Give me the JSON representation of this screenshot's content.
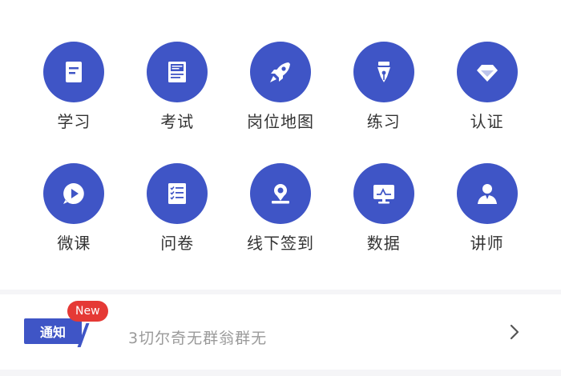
{
  "theme": {
    "accent": "#3f55c6",
    "new_badge": "#e53935"
  },
  "menu": {
    "items": [
      {
        "label": "学习",
        "icon": "document-icon"
      },
      {
        "label": "考试",
        "icon": "exam-paper-icon"
      },
      {
        "label": "岗位地图",
        "icon": "rocket-icon"
      },
      {
        "label": "练习",
        "icon": "pen-nib-icon"
      },
      {
        "label": "认证",
        "icon": "diamond-icon"
      },
      {
        "label": "微课",
        "icon": "play-bubble-icon"
      },
      {
        "label": "问卷",
        "icon": "checklist-icon"
      },
      {
        "label": "线下签到",
        "icon": "location-pin-icon"
      },
      {
        "label": "数据",
        "icon": "monitor-chart-icon"
      },
      {
        "label": "讲师",
        "icon": "lecturer-icon"
      }
    ]
  },
  "notice": {
    "badge_label": "通知",
    "new_label": "New",
    "text": "3切尔奇无群翁群无",
    "chevron_icon": "chevron-right-icon"
  }
}
